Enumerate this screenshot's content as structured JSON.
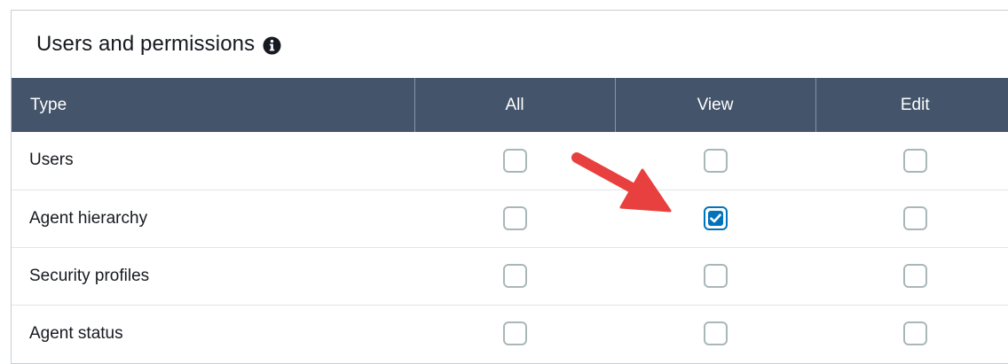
{
  "panel": {
    "title": "Users and permissions",
    "info_icon": "info-circle-icon"
  },
  "table": {
    "headers": {
      "type": "Type",
      "all": "All",
      "view": "View",
      "edit": "Edit"
    },
    "rows": [
      {
        "type": "Users",
        "all": false,
        "view": false,
        "edit": false
      },
      {
        "type": "Agent hierarchy",
        "all": false,
        "view": true,
        "edit": false
      },
      {
        "type": "Security profiles",
        "all": false,
        "view": false,
        "edit": false
      },
      {
        "type": "Agent status",
        "all": false,
        "view": false,
        "edit": false
      }
    ]
  },
  "annotation": {
    "arrow_color": "#e8403e",
    "arrow_target": "Agent hierarchy - View checkbox"
  },
  "colors": {
    "header_bg": "#44546a",
    "checkbox_checked": "#0073bb",
    "checkbox_border": "#aab7b8"
  }
}
